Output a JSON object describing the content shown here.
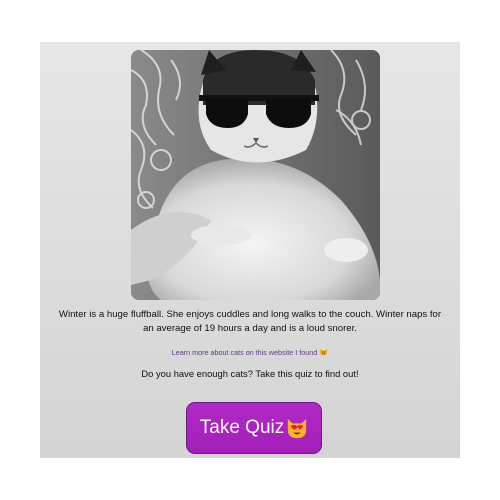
{
  "photo": {
    "alt_icon": "cat-with-sunglasses-photo"
  },
  "bio_text": "Winter is a huge fluffball. She enjoys cuddles and long walks to the couch. Winter naps for an average of 19 hours a day and is a loud snorer.",
  "learn_link": {
    "label": "Learn more about cats on this website I found",
    "icon": "smiling-cat-icon"
  },
  "quiz_prompt": "Do you have enough cats? Take this quiz to find out!",
  "quiz_button": {
    "label": "Take Quiz",
    "icon": "heart-eyes-cat-icon"
  },
  "colors": {
    "button_bg": "#a31eb8",
    "link": "#5a3a8a",
    "card_bg": "#dcdcdc"
  }
}
